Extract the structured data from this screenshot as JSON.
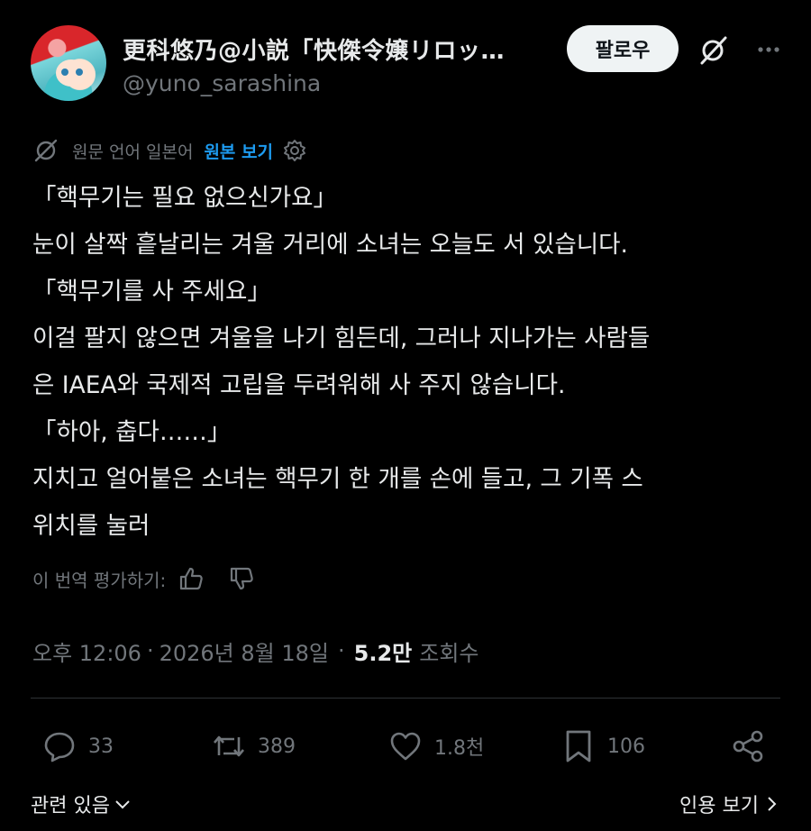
{
  "author": {
    "display_name": "更科悠乃@小説「快傑令嬢リロッ…",
    "handle": "@yuno_sarashina",
    "follow_label": "팔로우"
  },
  "icons": {
    "grok": "grok-icon",
    "more": "more-dots-icon",
    "translate": "translate-icon",
    "settings": "gear-icon",
    "thumbs_up": "thumbs-up-icon",
    "thumbs_down": "thumbs-down-icon",
    "reply": "reply-icon",
    "repost": "repost-icon",
    "like": "heart-icon",
    "bookmark": "bookmark-icon",
    "share": "share-icon"
  },
  "translation": {
    "label": "원문 언어 일본어",
    "show_original": "원본 보기"
  },
  "post": {
    "lines": [
      "「핵무기는 필요 없으신가요」",
      "눈이 살짝 흩날리는 겨울 거리에 소녀는 오늘도 서 있습니다.",
      "「핵무기를 사 주세요」",
      "이걸 팔지 않으면 겨울을 나기 힘든데, 그러나 지나가는 사람들",
      "은 IAEA와 국제적 고립을 두려워해 사 주지 않습니다.",
      "「하아, 춥다……」",
      "지치고 얼어붙은 소녀는 핵무기 한 개를 손에 들고, 그 기폭 스",
      "위치를 눌러"
    ]
  },
  "rating": {
    "label": "이 번역 평가하기:"
  },
  "meta": {
    "time": "오후 12:06",
    "separator": "·",
    "date": "2026년 8월 18일",
    "separator2": "·",
    "views_count": "5.2만",
    "views_label": "조회수"
  },
  "actions": {
    "replies": "33",
    "reposts": "389",
    "likes": "1.8천",
    "bookmarks": "106"
  },
  "footer": {
    "related": "관련 있음",
    "quotes": "인용 보기"
  },
  "colors": {
    "background": "#000000",
    "text": "#e7e9ea",
    "muted": "#71767b",
    "accent": "#1d9bf0",
    "divider": "#2f3336"
  }
}
